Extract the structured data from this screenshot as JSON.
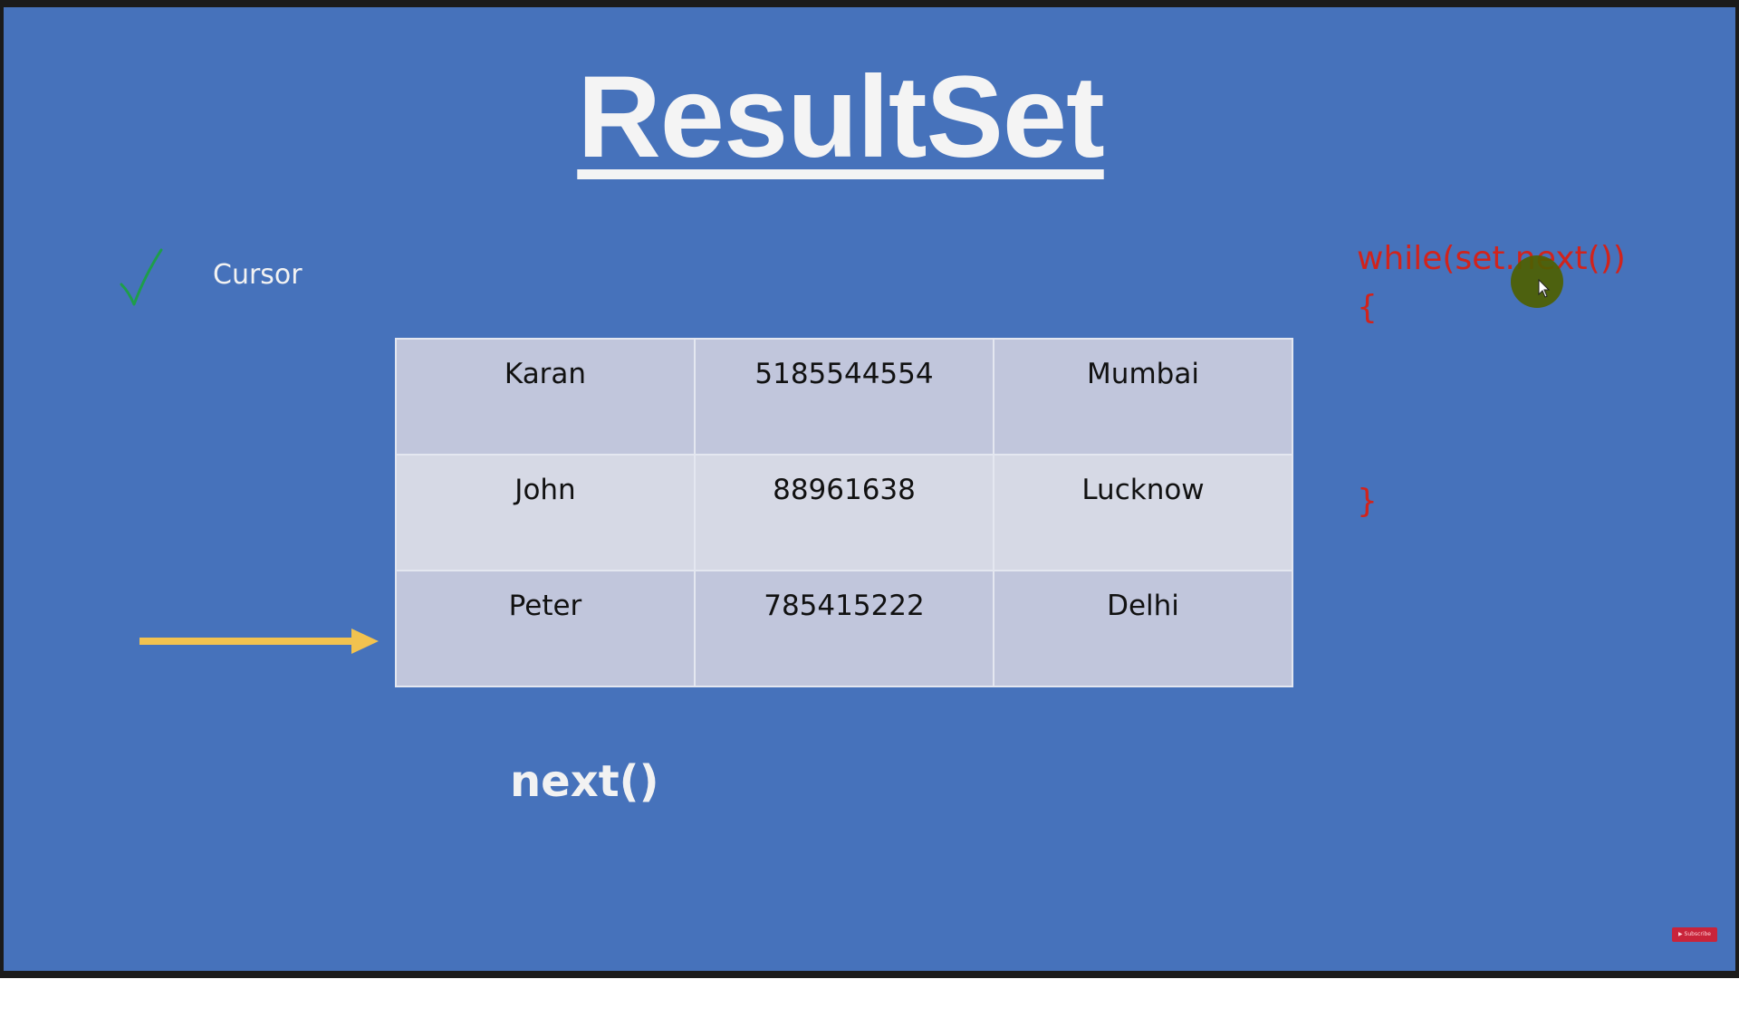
{
  "slide": {
    "title": "ResultSet",
    "bullet_label": "Cursor",
    "method_label": "next()"
  },
  "table": {
    "rows": [
      [
        "Karan",
        "5185544554",
        "Mumbai"
      ],
      [
        "John",
        "88961638",
        "Lucknow"
      ],
      [
        "Peter",
        "785415222",
        "Delhi"
      ]
    ]
  },
  "code": {
    "line1": "while(set.next())",
    "line2": "{",
    "line3": "}"
  },
  "icons": {
    "check": "checkmark-icon",
    "arrow": "right-arrow-icon",
    "pointer": "mouse-pointer-icon",
    "subscribe": "subscribe-button"
  },
  "colors": {
    "slide_background": "#4672bb",
    "code_text": "#d1231c",
    "arrow": "#f2c24f",
    "check": "#1e9e4a",
    "table_row_dark": "#c1c6dc",
    "table_row_light": "#d6d9e5"
  }
}
